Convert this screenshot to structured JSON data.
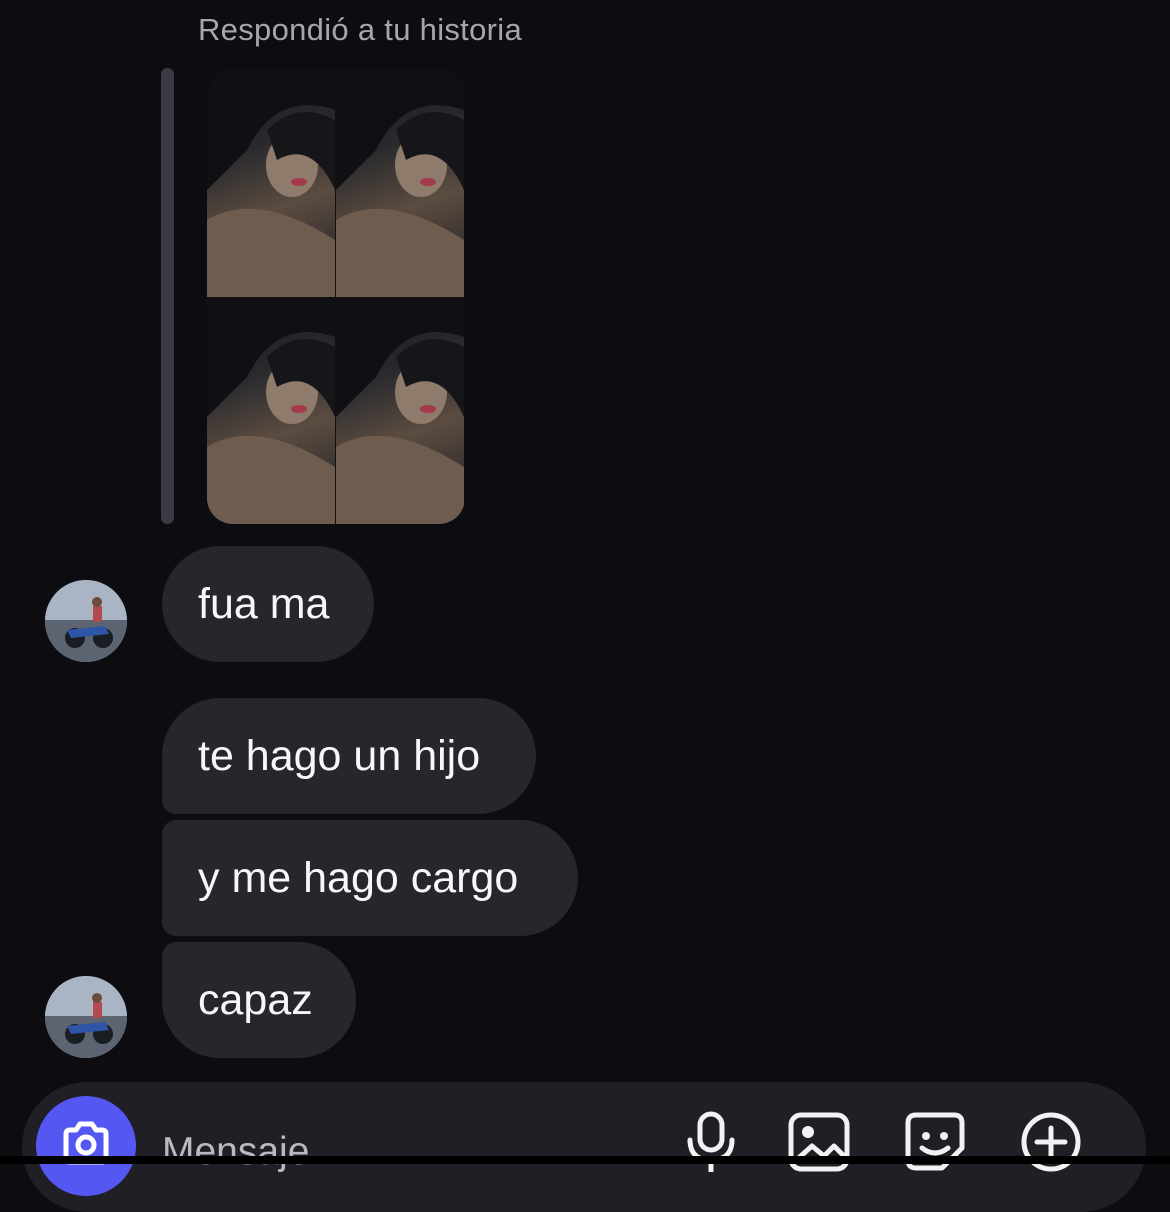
{
  "chat": {
    "reply_header": "Respondió a tu historia",
    "messages": [
      {
        "text": "fua ma",
        "avatar": true
      },
      {
        "text": "te hago un hijo",
        "avatar": false
      },
      {
        "text": "y me hago cargo",
        "avatar": false
      },
      {
        "text": "capaz",
        "avatar": true
      }
    ]
  },
  "composer": {
    "placeholder": "Mensaje..."
  },
  "icons": {
    "camera": "camera-icon",
    "microphone": "microphone-icon",
    "gallery": "gallery-icon",
    "sticker": "sticker-icon",
    "plus": "plus-circle-icon"
  },
  "colors": {
    "background": "#0c0c11",
    "bubble": "#26262c",
    "composer": "#1f1f25",
    "accent": "#5557f2",
    "muted_text": "#a6a6ad"
  }
}
